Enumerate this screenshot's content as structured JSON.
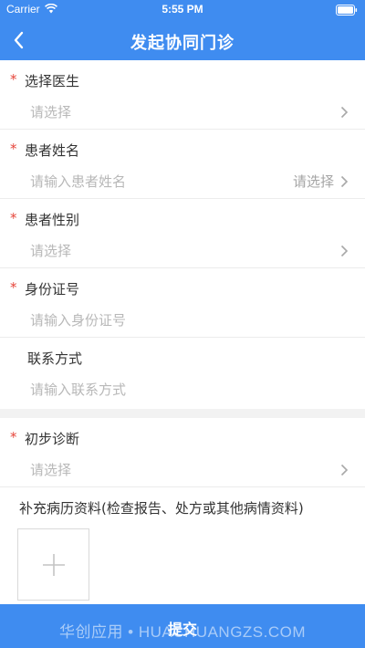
{
  "status_bar": {
    "carrier": "Carrier",
    "time": "5:55 PM"
  },
  "nav": {
    "title": "发起协同门诊"
  },
  "colors": {
    "primary": "#3f8cf0",
    "required": "#e6453a",
    "placeholder": "#b8b8b8"
  },
  "form": {
    "doctor": {
      "label": "选择医生",
      "placeholder": "请选择",
      "required": true
    },
    "patient_name": {
      "label": "患者姓名",
      "placeholder": "请输入患者姓名",
      "right_text": "请选择",
      "required": true
    },
    "gender": {
      "label": "患者性别",
      "placeholder": "请选择",
      "required": true
    },
    "id_number": {
      "label": "身份证号",
      "placeholder": "请输入身份证号",
      "required": true
    },
    "contact": {
      "label": "联系方式",
      "placeholder": "请输入联系方式",
      "required": false
    },
    "diagnosis": {
      "label": "初步诊断",
      "placeholder": "请选择",
      "required": true
    }
  },
  "supplement": {
    "label": "补充病历资料(检查报告、处方或其他病情资料)",
    "upload_icon": "plus-icon"
  },
  "footer": {
    "submit_label": "提交",
    "watermark": "华创应用 • HUACHUANGZS.COM"
  },
  "required_mark": "*"
}
